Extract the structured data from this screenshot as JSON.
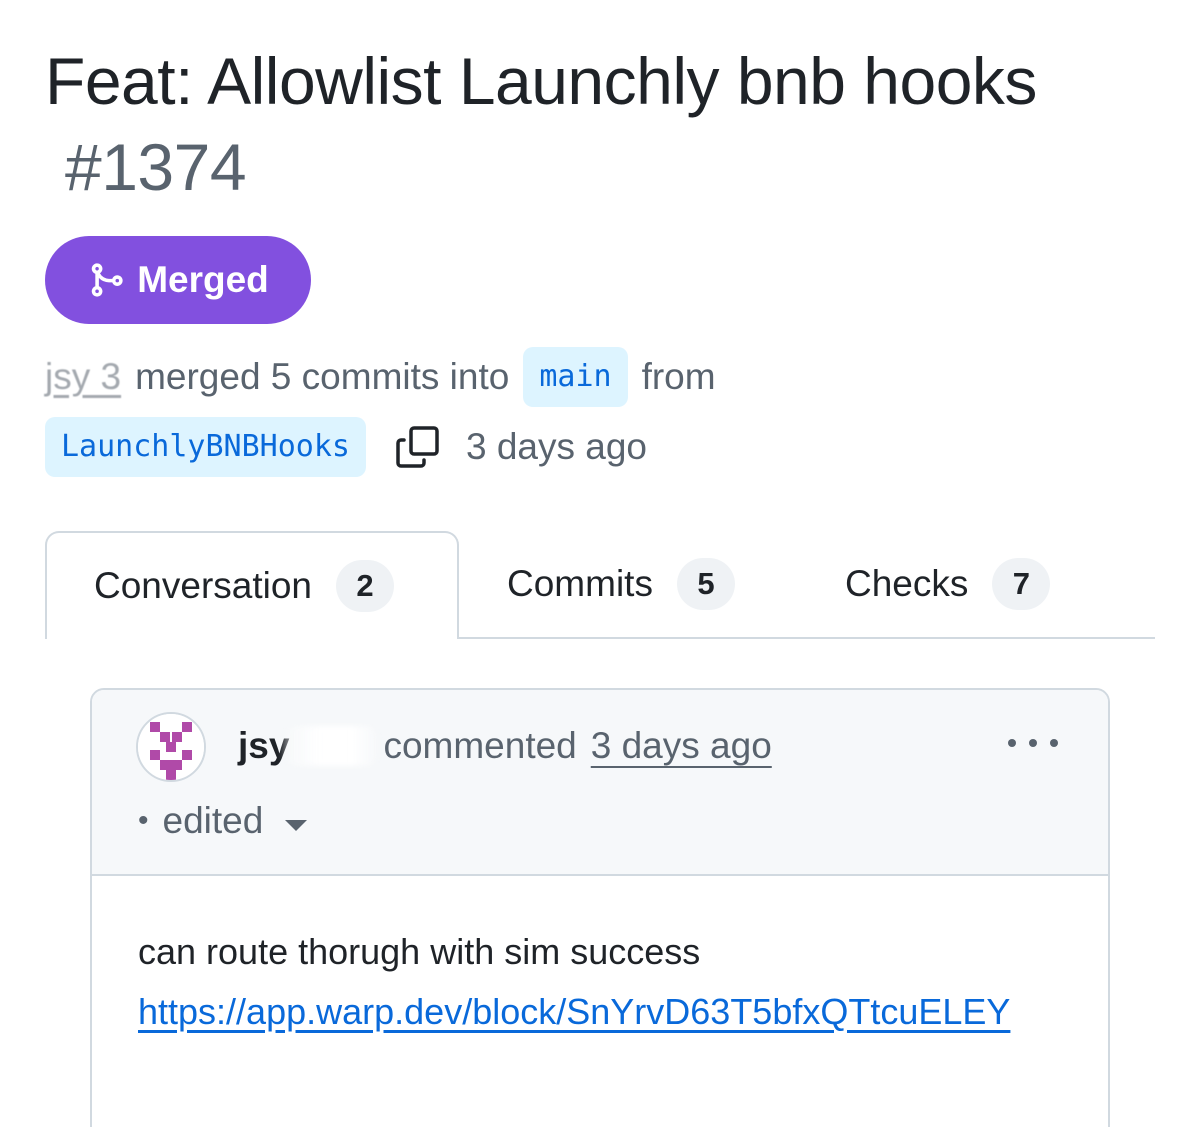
{
  "pr": {
    "title": "Feat: Allowlist Launchly bnb hooks",
    "number": "#1374",
    "state": "Merged",
    "state_color": "#8250df"
  },
  "meta": {
    "author": "jsy      3",
    "merged_text": "merged 5 commits into",
    "base_branch": "main",
    "from_text": "from",
    "head_branch": "LaunchlyBNBHooks",
    "time": "3 days ago"
  },
  "tabs": [
    {
      "label": "Conversation",
      "count": "2",
      "selected": true
    },
    {
      "label": "Commits",
      "count": "5",
      "selected": false
    },
    {
      "label": "Checks",
      "count": "7",
      "selected": false
    }
  ],
  "comment": {
    "author": "jsy",
    "action": "commented",
    "time": "3 days ago",
    "edited": "edited",
    "body_text": "can route thorugh with sim success",
    "link": "https://app.warp.dev/block/SnYrvD63T5bfxQTtcuELEY"
  },
  "icons": {
    "merge": "git-merge-icon",
    "copy": "copy-icon",
    "more": "kebab-horizontal-icon",
    "caret": "triangle-down-icon"
  }
}
